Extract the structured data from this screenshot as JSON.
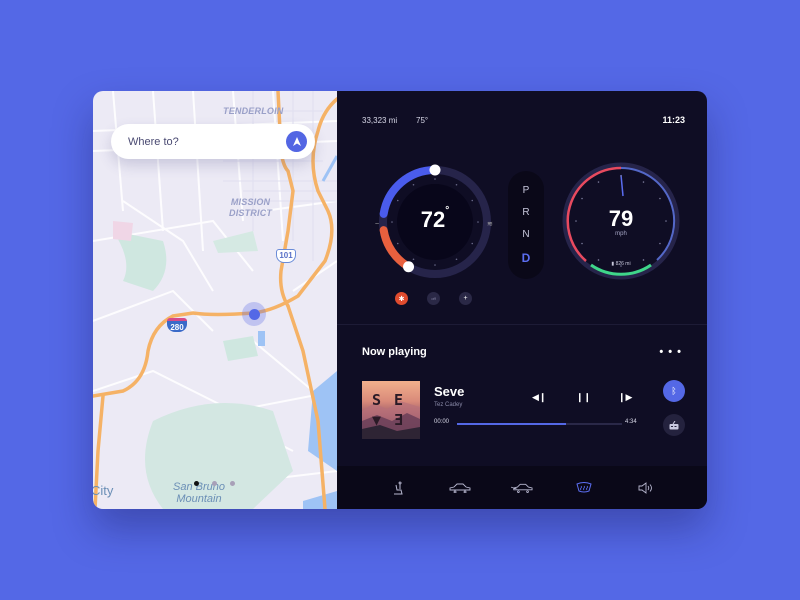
{
  "map": {
    "search_placeholder": "Where to?",
    "nav_icon": "navigation-arrow-icon",
    "labels": {
      "tenderloin": "TENDERLOIN",
      "mission_district_1": "MISSION",
      "mission_district_2": "DISTRICT",
      "san_bruno_1": "San Bruno",
      "san_bruno_2": "Mountain",
      "city_fragment": "City"
    },
    "shields": {
      "us101": "101",
      "i280": "280"
    },
    "colors": {
      "highway": "#f5b266",
      "water": "#9ec3f5",
      "park": "#cde6df",
      "accent": "#5468e6"
    }
  },
  "status": {
    "odometer": "33,323 mi",
    "outside_temp": "75°",
    "clock": "11:23"
  },
  "climate": {
    "temperature": "72",
    "degree": "°",
    "left_icon": "fan-low-icon",
    "right_icon": "heat-waves-icon",
    "buttons": [
      {
        "name": "heat",
        "label": "✱",
        "color": "#e04b2e"
      },
      {
        "name": "off",
        "label": "off",
        "color": "#2a2846"
      },
      {
        "name": "add",
        "label": "+",
        "color": "#2a2846"
      }
    ],
    "cool_fraction": 0.28,
    "heat_fraction": 0.14
  },
  "gear": {
    "options": [
      "P",
      "R",
      "N",
      "D"
    ],
    "selected": "D"
  },
  "speedometer": {
    "speed": "79",
    "unit": "mph",
    "range": "826 mi",
    "battery_icon": "battery-icon",
    "colors": {
      "speed": "#e84a5f",
      "battery": "#3fd68a",
      "track": "#5468c8"
    }
  },
  "now_playing": {
    "title": "Now playing",
    "more_icon": "more-dots-icon",
    "song": "Seve",
    "artist": "Tez Cadey",
    "album_text": [
      "S",
      "E",
      "▼",
      "Ǝ"
    ],
    "time_current": "00:00",
    "time_total": "4:34",
    "progress": 0.66,
    "controls": [
      "previous-icon",
      "pause-icon",
      "next-icon"
    ],
    "sources": [
      "bluetooth-icon",
      "radio-icon"
    ]
  },
  "bottom_bar": {
    "items": [
      "seat-icon",
      "car-front-icon",
      "car-rear-icon",
      "defrost-icon",
      "volume-icon"
    ],
    "active": "defrost-icon"
  }
}
